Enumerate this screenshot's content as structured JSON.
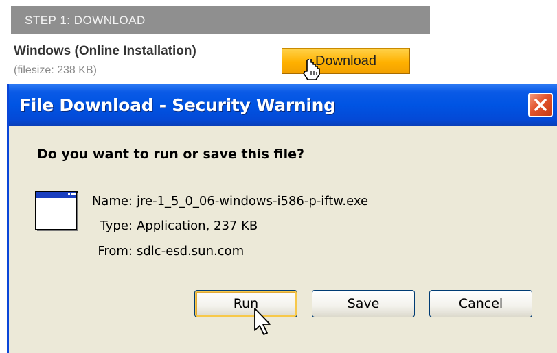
{
  "page": {
    "step_label": "STEP 1: DOWNLOAD",
    "os_title": "Windows (Online Installation)",
    "filesize": "(filesize: 238 KB)",
    "download_label": "Download"
  },
  "dialog": {
    "title": "File Download - Security Warning",
    "question": "Do you want to run or save this file?",
    "fields": [
      {
        "label": "Name:",
        "value": "jre-1_5_0_06-windows-i586-p-iftw.exe"
      },
      {
        "label": "Type:",
        "value": "Application, 237 KB"
      },
      {
        "label": "From:",
        "value": "sdlc-esd.sun.com"
      }
    ],
    "buttons": {
      "run": "Run",
      "save": "Save",
      "cancel": "Cancel"
    }
  },
  "colors": {
    "titlebar_blue": "#0054e3",
    "dialog_bg": "#ece9d8",
    "download_orange": "#ffb100",
    "close_red": "#e2542d"
  },
  "icons": [
    "close-x-icon",
    "application-window-icon",
    "hand-cursor-icon",
    "arrow-cursor-icon"
  ]
}
